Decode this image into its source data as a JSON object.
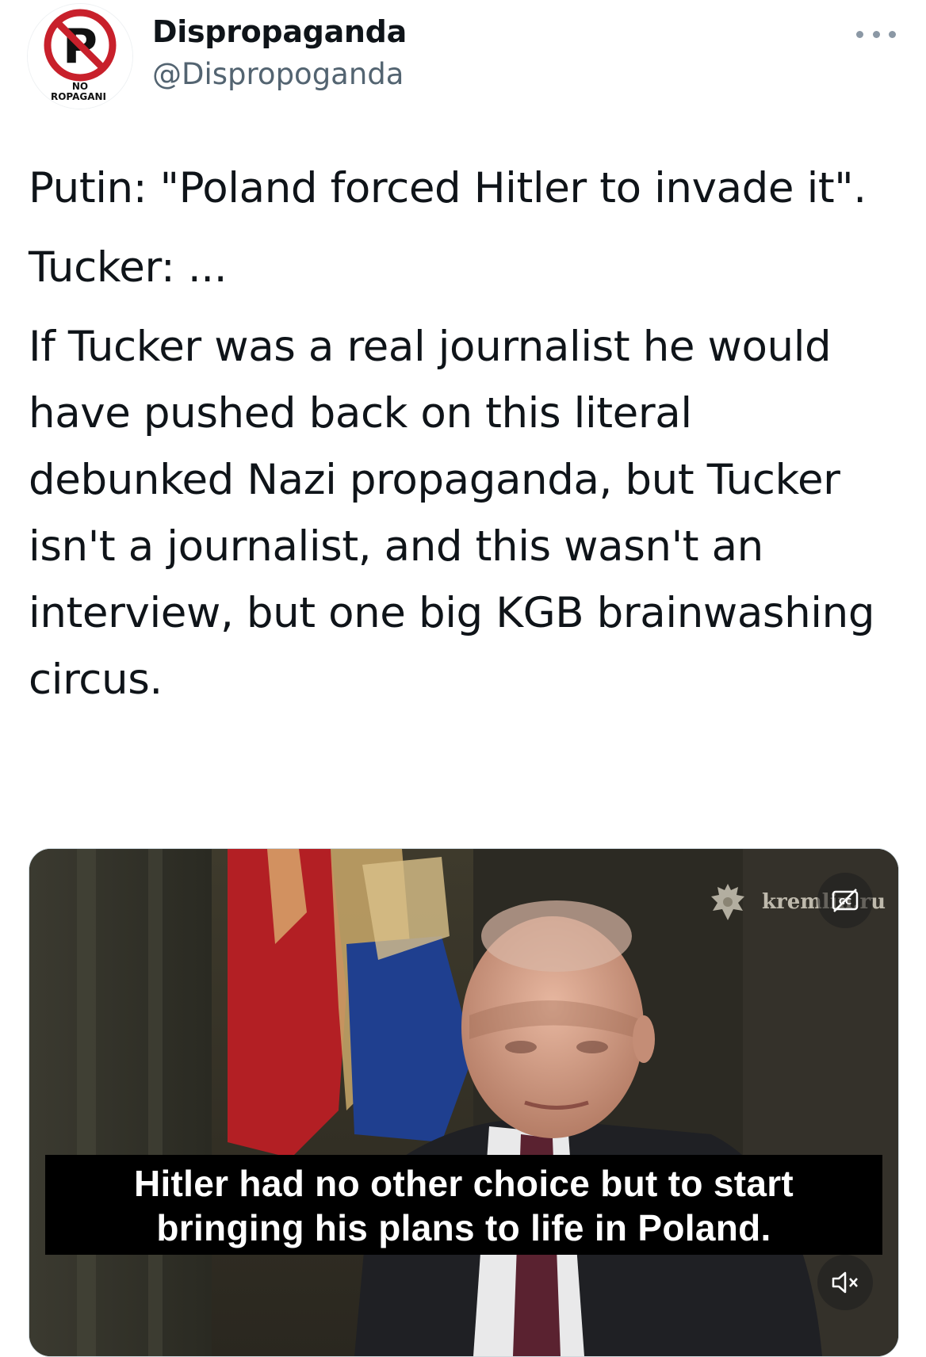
{
  "author": {
    "display_name": "Dispropaganda",
    "handle": "@Dispropoganda",
    "avatar": {
      "icon": "no-propaganda-prohibition-icon",
      "letter": "P",
      "caption_line1": "NO",
      "caption_line2": "ROPAGANI"
    }
  },
  "more_icon": "more-options-icon",
  "tweet": {
    "paragraphs": [
      "Putin: \"Poland forced Hitler to invade it\".",
      "Tucker: ...",
      "If Tucker was a real journalist he would have pushed back on this literal debunked Nazi propaganda, but Tucker isn't a journalist, and this wasn't an interview, but one big KGB brainwashing circus."
    ]
  },
  "media": {
    "type": "video",
    "watermark_text": "kremlin.ru",
    "watermark_icon": "russian-coat-of-arms-icon",
    "captions_icon": "closed-captions-off-icon",
    "mute_icon": "muted-speaker-icon",
    "subtitle_lines": [
      "Hitler had no other choice but to start",
      "bringing his plans to life in Poland."
    ]
  },
  "colors": {
    "text": "#0f1419",
    "secondary_text": "#536471",
    "prohibition_red": "#c8202b",
    "subtitle_bg": "#000000"
  }
}
